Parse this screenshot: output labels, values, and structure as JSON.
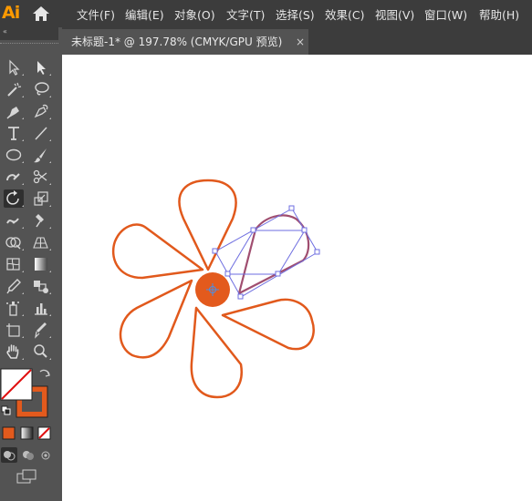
{
  "app": {
    "logo": "Ai"
  },
  "menus": [
    {
      "label": "文件(F)"
    },
    {
      "label": "编辑(E)"
    },
    {
      "label": "对象(O)"
    },
    {
      "label": "文字(T)"
    },
    {
      "label": "选择(S)"
    },
    {
      "label": "效果(C)"
    },
    {
      "label": "视图(V)"
    },
    {
      "label": "窗口(W)"
    },
    {
      "label": "帮助(H)"
    }
  ],
  "document_tab": {
    "title": "未标题-1* @ 197.78% (CMYK/GPU 预览)",
    "close_glyph": "×"
  },
  "toolbar": {
    "collapse_glyph": "«"
  },
  "colors": {
    "accent": "#e35a1d",
    "stroke_orange": "#e1591c",
    "selection": "#6e6ee0",
    "ui_dark": "#3c3c3c",
    "ui_mid": "#535353"
  },
  "tools": [
    {
      "name": "selection-tool-icon"
    },
    {
      "name": "direct-selection-tool-icon"
    },
    {
      "name": "magic-wand-tool-icon"
    },
    {
      "name": "lasso-tool-icon"
    },
    {
      "name": "pen-tool-icon"
    },
    {
      "name": "curvature-tool-icon"
    },
    {
      "name": "type-tool-icon"
    },
    {
      "name": "line-segment-tool-icon"
    },
    {
      "name": "ellipse-tool-icon"
    },
    {
      "name": "paintbrush-tool-icon"
    },
    {
      "name": "shaper-tool-icon"
    },
    {
      "name": "scissors-tool-icon"
    },
    {
      "name": "rotate-tool-icon"
    },
    {
      "name": "scale-tool-icon"
    },
    {
      "name": "width-tool-icon"
    },
    {
      "name": "puppet-warp-tool-icon"
    },
    {
      "name": "shape-builder-tool-icon"
    },
    {
      "name": "perspective-grid-tool-icon"
    },
    {
      "name": "mesh-tool-icon"
    },
    {
      "name": "gradient-tool-icon"
    },
    {
      "name": "eyedropper-tool-icon"
    },
    {
      "name": "blend-tool-icon"
    },
    {
      "name": "symbol-sprayer-tool-icon"
    },
    {
      "name": "column-graph-tool-icon"
    },
    {
      "name": "artboard-tool-icon"
    },
    {
      "name": "slice-tool-icon"
    },
    {
      "name": "hand-tool-icon"
    },
    {
      "name": "zoom-tool-icon"
    }
  ]
}
